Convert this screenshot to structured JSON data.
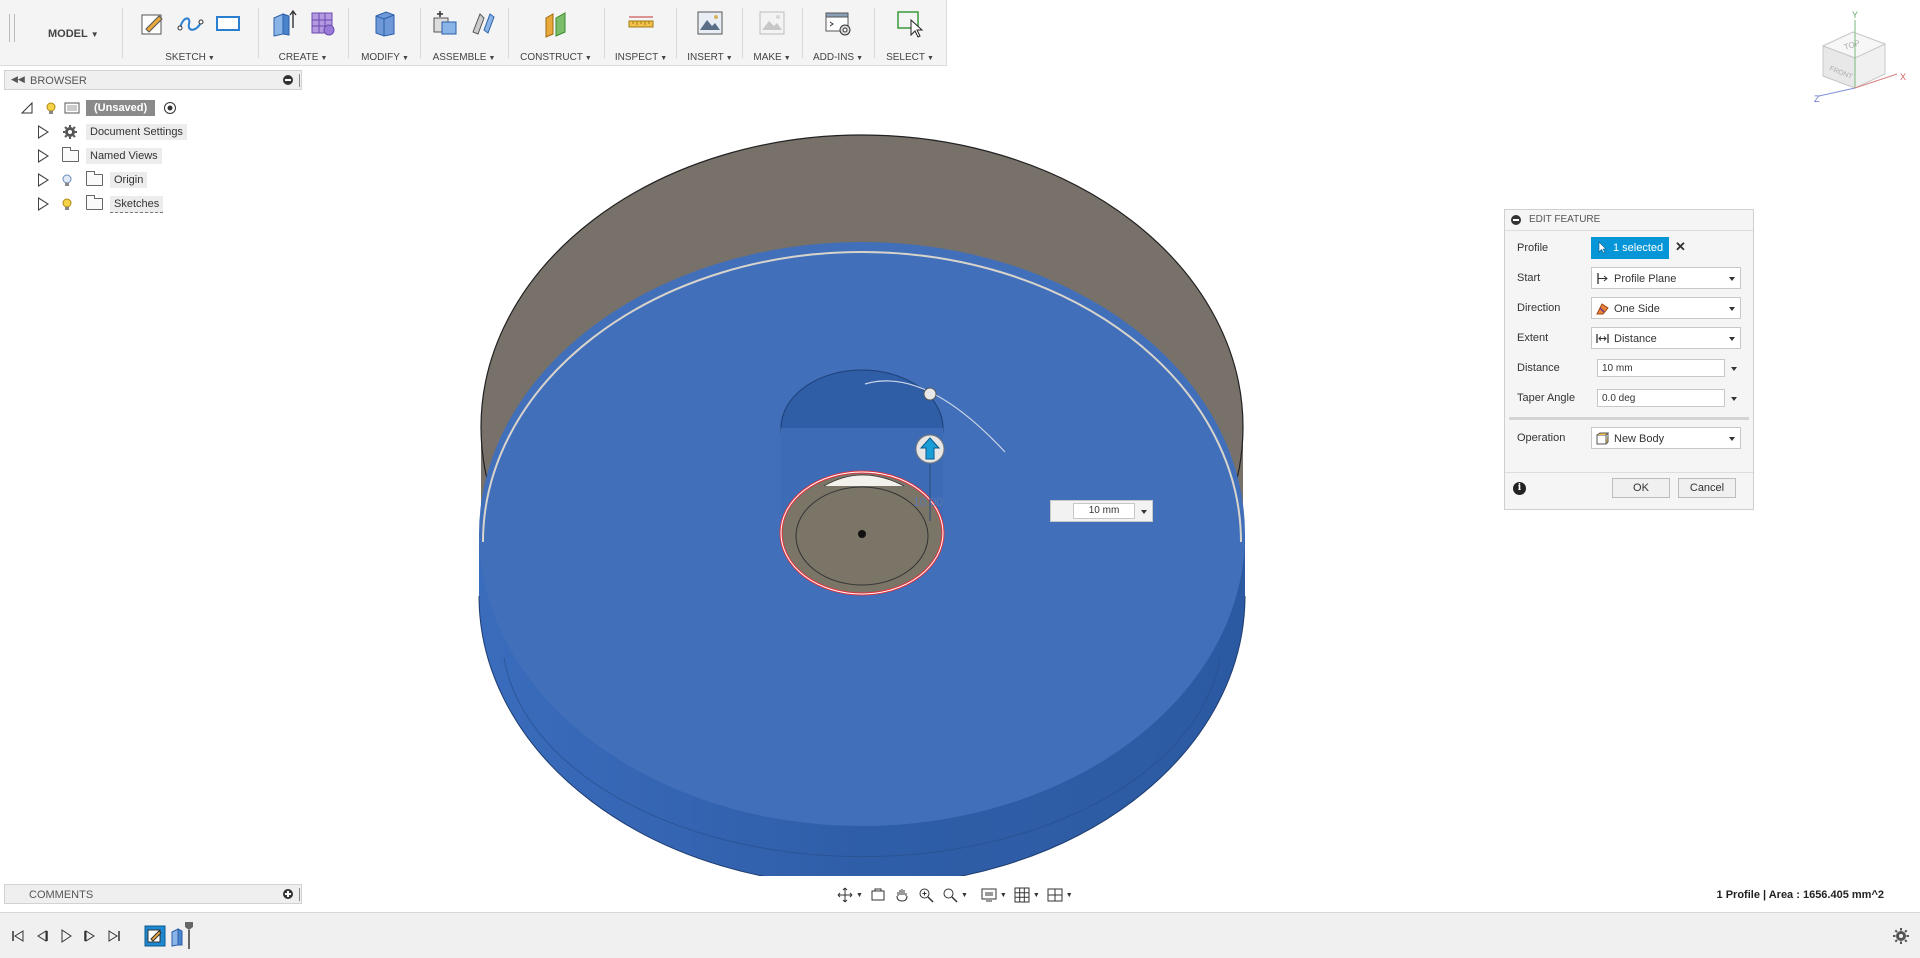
{
  "toolbar": {
    "workspace": "MODEL",
    "groups": [
      {
        "label": "SKETCH"
      },
      {
        "label": "CREATE"
      },
      {
        "label": "MODIFY"
      },
      {
        "label": "ASSEMBLE"
      },
      {
        "label": "CONSTRUCT"
      },
      {
        "label": "INSPECT"
      },
      {
        "label": "INSERT"
      },
      {
        "label": "MAKE"
      },
      {
        "label": "ADD-INS"
      },
      {
        "label": "SELECT"
      }
    ]
  },
  "browser": {
    "title": "BROWSER",
    "root": "(Unsaved)",
    "items": [
      {
        "label": "Document Settings",
        "icon": "gear-icon"
      },
      {
        "label": "Named Views",
        "icon": "folder-icon"
      },
      {
        "label": "Origin",
        "icon": "folder-icon"
      },
      {
        "label": "Sketches",
        "icon": "folder-icon"
      }
    ]
  },
  "dialog": {
    "title": "EDIT FEATURE",
    "profile_label": "Profile",
    "profile_value": "1 selected",
    "start_label": "Start",
    "start_value": "Profile Plane",
    "direction_label": "Direction",
    "direction_value": "One Side",
    "extent_label": "Extent",
    "extent_value": "Distance",
    "distance_label": "Distance",
    "distance_value": "10 mm",
    "taper_label": "Taper Angle",
    "taper_value": "0.0 deg",
    "operation_label": "Operation",
    "operation_value": "New Body",
    "ok_label": "OK",
    "cancel_label": "Cancel"
  },
  "manipulator": {
    "distance_value": "10 mm",
    "dimension_text": "10.00"
  },
  "viewcube": {
    "top": "TOP",
    "front": "FRONT",
    "axis_x": "X",
    "axis_y": "Y",
    "axis_z": "Z"
  },
  "comments": {
    "title": "COMMENTS"
  },
  "status": {
    "text": "1 Profile | Area : 1656.405 mm^2"
  },
  "colors": {
    "accent": "#0696d7",
    "body_blue": "#3f6fba",
    "body_side": "#2f5ea8",
    "inner_gray": "#7a7368",
    "profile_red": "#e0323c"
  }
}
